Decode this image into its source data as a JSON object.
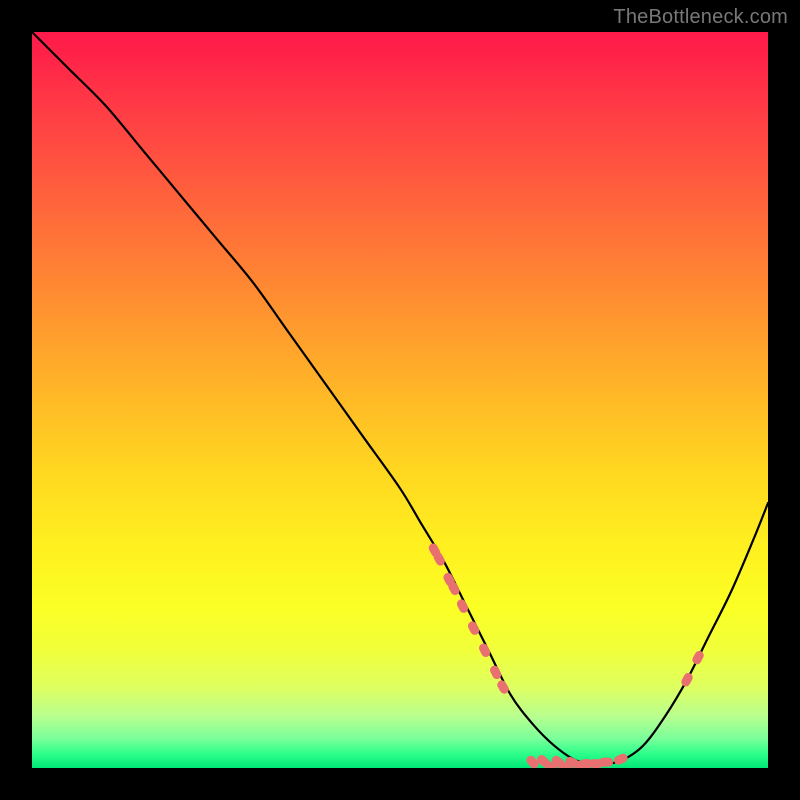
{
  "watermark": "TheBottleneck.com",
  "chart_data": {
    "type": "line",
    "title": "",
    "xlabel": "",
    "ylabel": "",
    "xlim": [
      0,
      100
    ],
    "ylim": [
      0,
      100
    ],
    "curve": {
      "x": [
        0,
        2,
        5,
        10,
        15,
        20,
        25,
        30,
        35,
        40,
        45,
        50,
        53,
        56,
        59,
        62,
        65,
        68,
        71,
        74,
        77,
        80,
        83,
        86,
        89,
        92,
        95,
        98,
        100
      ],
      "y": [
        100,
        98,
        95,
        90,
        84,
        78,
        72,
        66,
        59,
        52,
        45,
        38,
        33,
        28,
        22,
        16,
        10,
        6,
        3,
        1,
        0.5,
        1,
        3,
        7,
        12,
        18,
        24,
        31,
        36
      ]
    },
    "markers": [
      {
        "type": "cluster",
        "x": 55,
        "y": 29,
        "count": 2
      },
      {
        "type": "cluster",
        "x": 57,
        "y": 25,
        "count": 2
      },
      {
        "type": "cluster",
        "x": 58.5,
        "y": 22,
        "count": 1
      },
      {
        "type": "cluster",
        "x": 60,
        "y": 19,
        "count": 1
      },
      {
        "type": "cluster",
        "x": 61.5,
        "y": 16,
        "count": 1
      },
      {
        "type": "cluster",
        "x": 63,
        "y": 13,
        "count": 1
      },
      {
        "type": "cluster",
        "x": 64,
        "y": 11,
        "count": 1
      },
      {
        "type": "cluster",
        "x": 68,
        "y": 0.8,
        "count": 1
      },
      {
        "type": "cluster",
        "x": 70,
        "y": 0.5,
        "count": 2
      },
      {
        "type": "cluster",
        "x": 72,
        "y": 0.4,
        "count": 2
      },
      {
        "type": "cluster",
        "x": 74,
        "y": 0.5,
        "count": 2
      },
      {
        "type": "cluster",
        "x": 76,
        "y": 0.6,
        "count": 2
      },
      {
        "type": "cluster",
        "x": 78,
        "y": 0.8,
        "count": 1
      },
      {
        "type": "cluster",
        "x": 80,
        "y": 1.2,
        "count": 1
      },
      {
        "type": "cluster",
        "x": 89,
        "y": 12,
        "count": 1
      },
      {
        "type": "cluster",
        "x": 90.5,
        "y": 15,
        "count": 1
      }
    ],
    "marker_color": "#e97070",
    "curve_color": "#000000"
  }
}
